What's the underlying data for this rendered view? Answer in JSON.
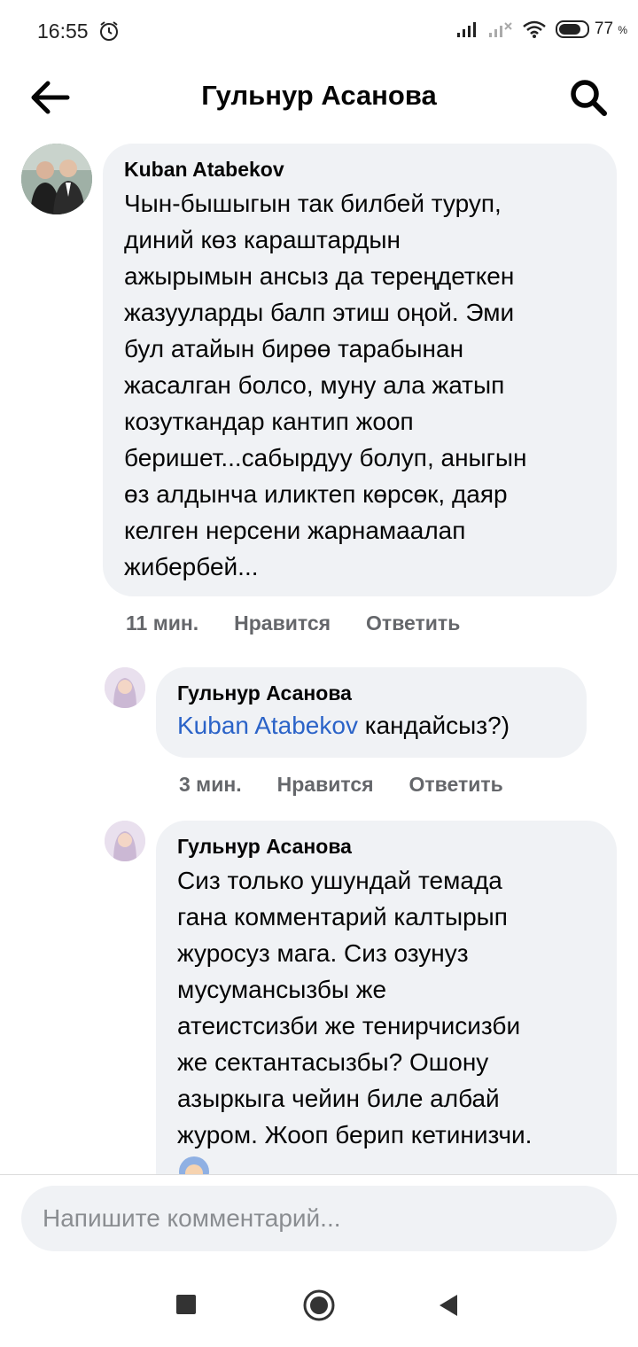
{
  "status_bar": {
    "time": "16:55",
    "battery_percent": "77",
    "battery_unit": "%"
  },
  "header": {
    "title": "Гульнур Асанова"
  },
  "comments": [
    {
      "author": "Kuban Atabekov",
      "text": "Чын-бышыгын так билбей туруп,\nдиний көз караштардын\nажырымын ансыз да тереңдеткен\nжазууларды балп этиш оңой. Эми\nбул атайын бирөө тарабынан\nжасалган болсо, муну ала жатып\nкозуткандар кантип жооп\nберишет...сабырдуу болуп, аныгын\nөз алдынча иликтеп көрсөк, даяр\nкелген нерсени жарнамаалап\nжибербей...",
      "time": "11 мин.",
      "like": "Нравится",
      "reply": "Ответить"
    },
    {
      "author": "Гульнур Асанова",
      "mention": "Kuban Atabekov",
      "text": " кандайсыз?)",
      "time": "3 мин.",
      "like": "Нравится",
      "reply": "Ответить"
    },
    {
      "author": "Гульнур Асанова",
      "text": "Сиз только ушундай темада\nгана комментарий калтырып\nжуросуз мага. Сиз озунуз\nмусумансызбы же\nатеистсизби же тенирчисизби\nже сектантасызбы? Ошону\nазыркыга чейин биле албай\nжуром. Жооп берип кетинизчи."
    }
  ],
  "composer": {
    "placeholder": "Напишите комментарий..."
  },
  "colors": {
    "bubble": "#f0f2f5",
    "mention": "#2b63c8",
    "meta": "#65676b"
  }
}
